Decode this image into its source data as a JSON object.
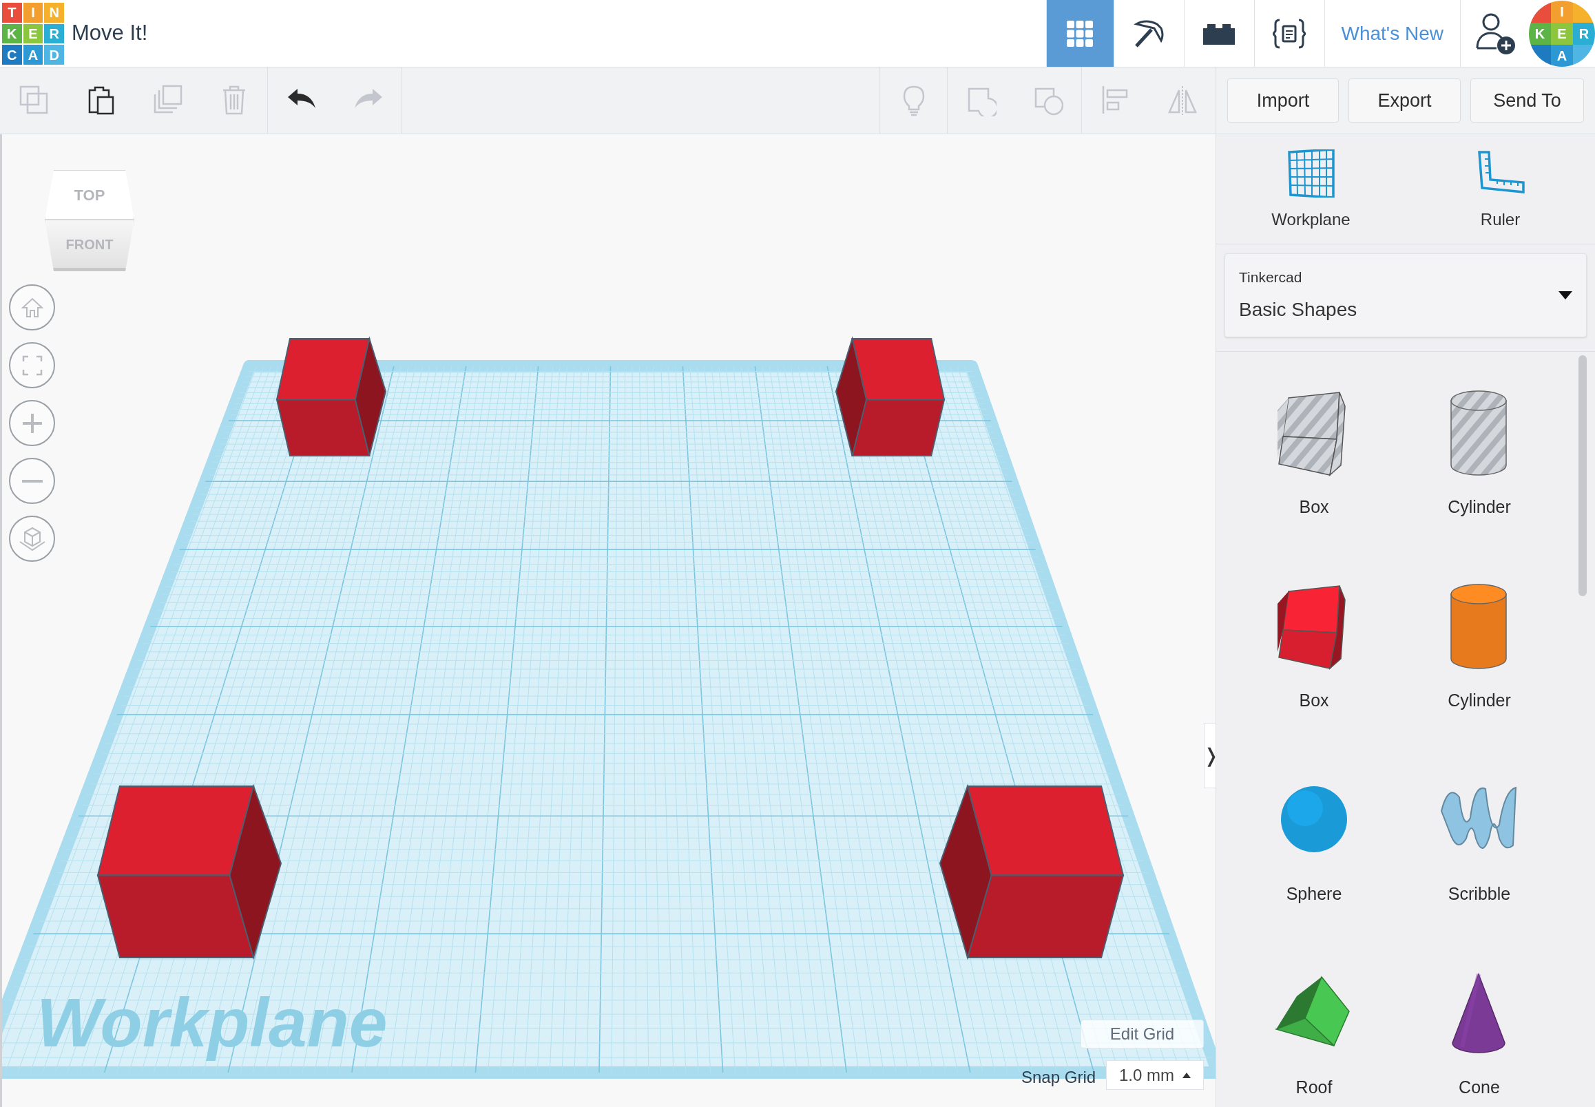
{
  "app": {
    "logo_letters": [
      "T",
      "I",
      "N",
      "K",
      "E",
      "R",
      "C",
      "A",
      "D"
    ],
    "title": "Move It!"
  },
  "view_modes": [
    {
      "selected": true
    },
    {
      "selected": false
    },
    {
      "selected": false
    },
    {
      "selected": false
    }
  ],
  "whats_new": "What's New",
  "avatar_letters": [
    "I",
    "K",
    "E",
    "R",
    "A"
  ],
  "toolbar": {
    "tools": [
      {
        "disabled": true
      },
      {
        "disabled": false
      },
      {
        "disabled": true
      },
      {
        "disabled": true
      },
      {
        "disabled": false
      },
      {
        "disabled": true
      },
      {
        "disabled": true
      },
      {
        "disabled": true
      },
      {
        "disabled": true
      },
      {
        "disabled": true
      },
      {
        "disabled": true
      }
    ],
    "buttons": [
      "Import",
      "Export",
      "Send To"
    ]
  },
  "view_cube": {
    "top": "TOP",
    "front": "FRONT"
  },
  "workplane_label": "Workplane",
  "edit_grid": "Edit Grid",
  "snap_grid": {
    "label": "Snap Grid",
    "value": "1.0 mm"
  },
  "collapse_toggle": "❭",
  "panel": {
    "tools": [
      "Workplane",
      "Ruler"
    ],
    "library": {
      "source": "Tinkercad",
      "name": "Basic Shapes"
    },
    "shapes": [
      {
        "label": "Box",
        "kind": "box",
        "hole": true
      },
      {
        "label": "Cylinder",
        "kind": "cylinder",
        "hole": true
      },
      {
        "label": "Box",
        "kind": "box",
        "hole": false,
        "color": "#d81f2f"
      },
      {
        "label": "Cylinder",
        "kind": "cylinder",
        "hole": false,
        "color": "#e87a1e"
      },
      {
        "label": "Sphere",
        "kind": "sphere",
        "hole": false,
        "color": "#1a9ad6"
      },
      {
        "label": "Scribble",
        "kind": "scribble",
        "hole": false,
        "color": "#8ec3e2"
      },
      {
        "label": "Roof",
        "kind": "roof",
        "hole": false,
        "color": "#3fae47"
      },
      {
        "label": "Cone",
        "kind": "cone",
        "hole": false,
        "color": "#7b3a96"
      }
    ]
  }
}
